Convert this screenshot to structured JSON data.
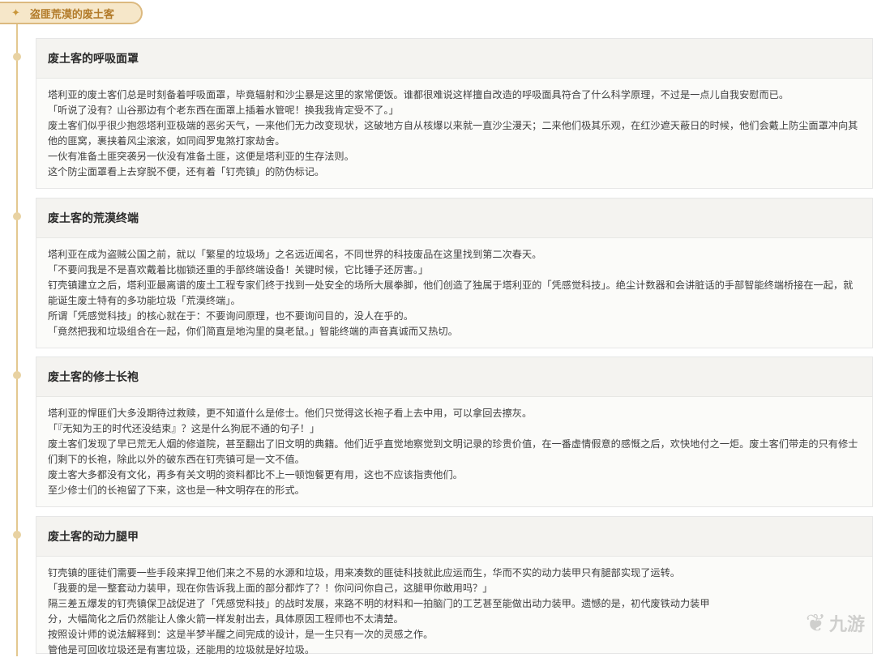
{
  "set_tab": {
    "title": "盗匪荒漠的废土客",
    "icon": "sparkle-icon"
  },
  "cards": [
    {
      "title": "废土客的呼吸面罩",
      "lines": [
        "塔利亚的废土客们总是时刻备着呼吸面罩，毕竟辐射和沙尘暴是这里的家常便饭。谁都很难说这样擅自改造的呼吸面具符合了什么科学原理，不过是一点儿自我安慰而已。",
        "「听说了没有？山谷那边有个老东西在面罩上插着水管呢！换我我肯定受不了。」",
        "废土客们似乎很少抱怨塔利亚极端的恶劣天气，一来他们无力改变现状，这破地方自从核爆以来就一直沙尘漫天；二来他们极其乐观，在红沙遮天蔽日的时候，他们会戴上防尘面罩冲向其他的匪窝，裹挟着风尘滚滚，如同阎罗鬼煞打家劫舍。",
        "一伙有准备土匪突袭另一伙没有准备土匪，这便是塔利亚的生存法则。",
        "这个防尘面罩看上去穿脱不便，还有着「钉壳镇」的防伪标记。"
      ]
    },
    {
      "title": "废土客的荒漠终端",
      "lines": [
        "塔利亚在成为盗贼公国之前，就以「繁星的垃圾场」之名远近闻名，不同世界的科技废品在这里找到第二次春天。",
        "「不要问我是不是喜欢戴着比枷锁还重的手部终端设备！关键时候，它比锤子还厉害。」",
        "钉壳镇建立之后，塔利亚最离谱的废土工程专家们终于找到一处安全的场所大展拳脚，他们创造了独属于塔利亚的「凭感觉科技」。绝尘计数器和会讲脏话的手部智能终端桥接在一起，就能诞生废土特有的多功能垃圾「荒漠终端」。",
        "所谓「凭感觉科技」的核心就在于：不要询问原理，也不要询问目的，没人在乎的。",
        "「竟然把我和垃圾组合在一起，你们简直是地沟里的臭老鼠。」智能终端的声音真诚而又热切。"
      ]
    },
    {
      "title": "废土客的修士长袍",
      "lines": [
        "塔利亚的悍匪们大多没期待过救赎，更不知道什么是修士。他们只觉得这长袍子看上去中用，可以拿回去擦灰。",
        "「『无知为王的时代还没结束』？这是什么狗屁不通的句子！」",
        "废土客们发现了早已荒无人烟的修道院，甚至翻出了旧文明的典籍。他们近乎直觉地察觉到文明记录的珍贵价值，在一番虚情假意的感慨之后，欢快地付之一炬。废土客们带走的只有修士们剩下的长袍，除此以外的破东西在钉壳镇可是一文不值。",
        "废土客大多都没有文化，再多有关文明的资料都比不上一顿饱餐更有用，这也不应该指责他们。",
        "至少修士们的长袍留了下来，这也是一种文明存在的形式。"
      ]
    },
    {
      "title": "废土客的动力腿甲",
      "lines": [
        "钉壳镇的匪徒们需要一些手段来捍卫他们来之不易的水源和垃圾，用来凑数的匪徒科技就此应运而生，华而不实的动力装甲只有腿部实现了运转。",
        "「我要的是一整套动力装甲，现在你告诉我上面的部分都炸了？！你问问你自己，这腿甲你敢用吗？」",
        "隔三差五爆发的钉壳镇保卫战促进了「凭感觉科技」的战时发展，来路不明的材料和一拍脑门的工艺甚至能做出动力装甲。遗憾的是，初代废铁动力装甲",
        "分，大幅简化之后仍然能让人像火箭一样发射出去，具体原因工程师也不太清楚。",
        "按照设计师的说法解释到：这是半梦半醒之间完成的设计，是一生只有一次的灵感之作。",
        "管他是可回收垃圾还是有害垃圾，还能用的垃圾就是好垃圾。"
      ]
    }
  ],
  "watermark": {
    "text": "九游",
    "icon": "jiuyou-logo-icon"
  }
}
